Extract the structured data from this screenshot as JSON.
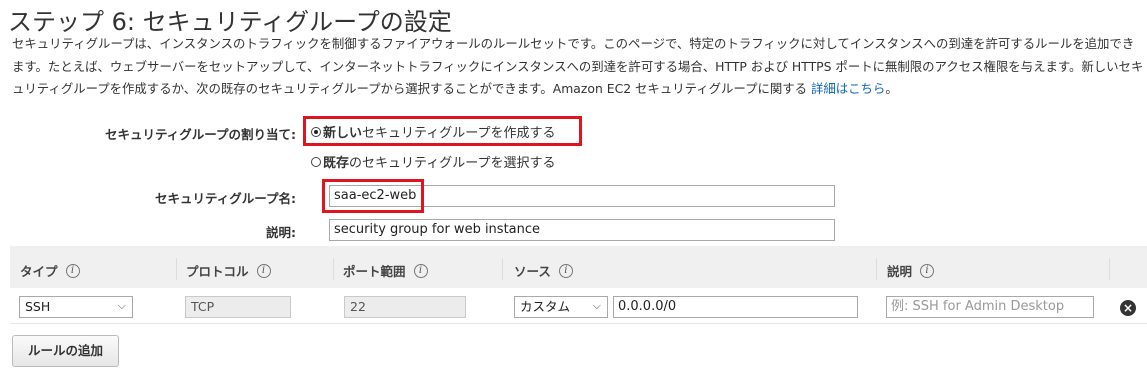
{
  "page": {
    "title": "ステップ 6: セキュリティグループの設定",
    "description_part1": "セキュリティグループは、インスタンスのトラフィックを制御するファイアウォールのルールセットです。このページで、特定のトラフィックに対してインスタンスへの到達を許可するルールを追加できます。たとえば、ウェブサーバーをセットアップして、インターネットトラフィックにインスタンスへの到達を許可する場合、HTTP および HTTPS ポートに無制限のアクセス権限を与えます。新しいセキュリティグループを作成するか、次の既存のセキュリティグループから選択することができます。Amazon EC2 セキュリティグループに関する",
    "description_link": "詳細はこちら",
    "description_end": "。"
  },
  "assign": {
    "label": "セキュリティグループの割り当て:",
    "option_new_bold": "新しい",
    "option_new_rest": "セキュリティグループを作成する",
    "option_existing_bold": "既存",
    "option_existing_rest": "のセキュリティグループを選択する"
  },
  "group_name": {
    "label": "セキュリティグループ名:",
    "value": "saa-ec2-web"
  },
  "group_desc": {
    "label": "説明:",
    "value": "security group for web instance"
  },
  "table": {
    "headers": {
      "type": "タイプ",
      "protocol": "プロトコル",
      "port": "ポート範囲",
      "source": "ソース",
      "description": "説明"
    },
    "info_glyph": "i",
    "row": {
      "type": "SSH",
      "protocol": "TCP",
      "port": "22",
      "source_mode": "カスタム",
      "source_cidr": "0.0.0.0/0",
      "description_placeholder": "例: SSH for Admin Desktop"
    }
  },
  "add_rule_label": "ルールの追加",
  "colors": {
    "highlight": "#e0141e",
    "link": "#1166bb",
    "header_bg": "#f0f0f0"
  },
  "icons": {
    "dropdown": "chevron-down-icon",
    "delete": "close-circle-icon",
    "info": "info-icon"
  }
}
